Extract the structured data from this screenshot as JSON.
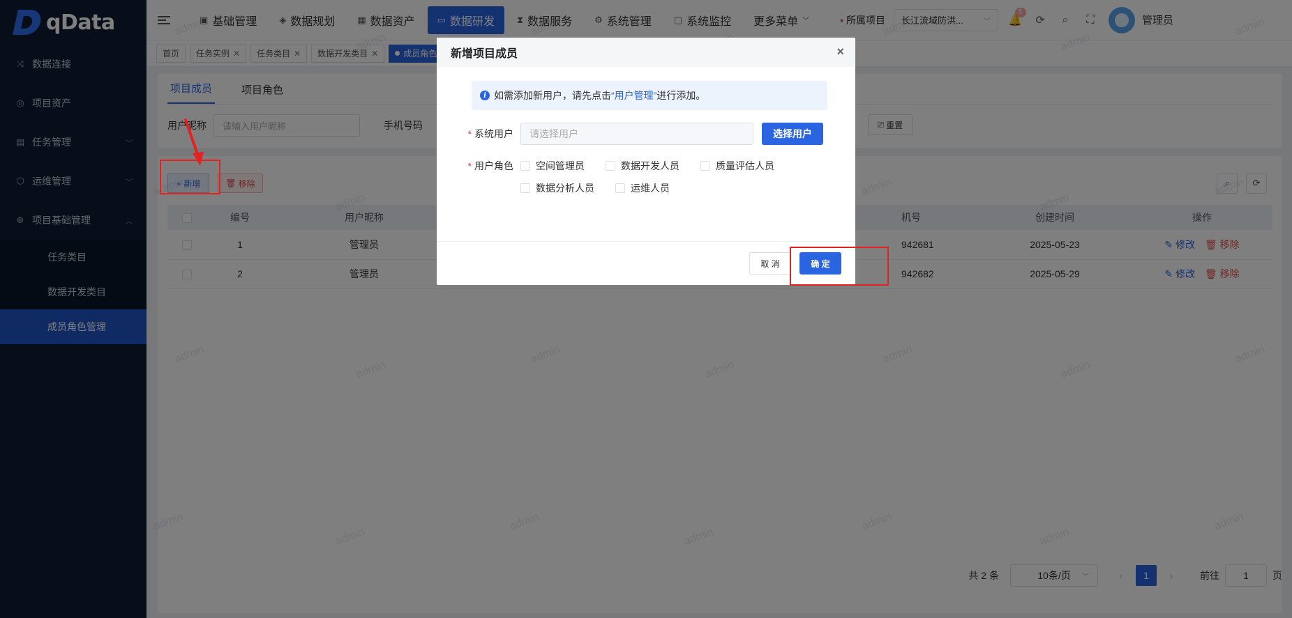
{
  "app": {
    "logo_text": "qData"
  },
  "sidebar": {
    "items": [
      {
        "label": "数据连接",
        "icon": "shuffle-icon"
      },
      {
        "label": "项目资产",
        "icon": "asset-icon"
      },
      {
        "label": "任务管理",
        "icon": "task-icon",
        "expandable": true
      },
      {
        "label": "运维管理",
        "icon": "ops-icon",
        "expandable": true
      },
      {
        "label": "项目基础管理",
        "icon": "basic-icon",
        "expanded": true
      }
    ],
    "subitems": [
      {
        "label": "任务类目"
      },
      {
        "label": "数据开发类目"
      },
      {
        "label": "成员角色管理",
        "active": true
      }
    ]
  },
  "header": {
    "nav": [
      {
        "label": "基础管理",
        "icon": "doc-icon"
      },
      {
        "label": "数据规划",
        "icon": "layers-icon"
      },
      {
        "label": "数据资产",
        "icon": "asset-icon"
      },
      {
        "label": "数据研发",
        "icon": "window-icon",
        "active": true
      },
      {
        "label": "数据服务",
        "icon": "hourglass-icon"
      },
      {
        "label": "系统管理",
        "icon": "gear-icon"
      },
      {
        "label": "系统监控",
        "icon": "monitor-icon"
      },
      {
        "label": "更多菜单"
      }
    ],
    "project_label": "所属项目",
    "project_value": "长江流域防洪...",
    "notification_badge": "5",
    "user_name": "管理员"
  },
  "tags": [
    {
      "label": "首页"
    },
    {
      "label": "任务实例",
      "closable": true
    },
    {
      "label": "任务类目",
      "closable": true
    },
    {
      "label": "数据开发类目",
      "closable": true
    },
    {
      "label": "成员角色",
      "active": true
    }
  ],
  "page": {
    "subtabs": [
      "项目成员",
      "项目角色"
    ],
    "search": {
      "nickname_label": "用户昵称",
      "nickname_placeholder": "请输入用户昵称",
      "phone_label": "手机号码",
      "reset_label": "重置"
    },
    "toolbar": {
      "add_label": "+ 新增",
      "remove_label": "移除"
    },
    "table": {
      "headers": [
        "编号",
        "用户昵称",
        "机号",
        "创建时间",
        "操作"
      ],
      "rows": [
        {
          "id": "1",
          "nickname": "管理员",
          "phone": "942681",
          "created": "2025-05-23"
        },
        {
          "id": "2",
          "nickname": "管理员",
          "phone": "942682",
          "created": "2025-05-29"
        }
      ],
      "edit_label": "修改",
      "remove_label": "移除"
    },
    "pagination": {
      "total_text": "共 2 条",
      "page_size": "10条/页",
      "current_page": "1",
      "goto_label": "前往",
      "goto_value": "1",
      "page_suffix": "页"
    }
  },
  "watermark": "admin",
  "modal": {
    "title": "新增项目成员",
    "alert_prefix": "如需添加新用户，请先点击",
    "alert_link": "“用户管理”",
    "alert_suffix": "进行添加。",
    "system_user_label": "系统用户",
    "system_user_placeholder": "请选择用户",
    "select_user_button": "选择用户",
    "role_label": "用户角色",
    "roles": [
      "空间管理员",
      "数据开发人员",
      "质量评估人员",
      "数据分析人员",
      "运维人员"
    ],
    "cancel_label": "取 消",
    "ok_label": "确 定"
  },
  "colors": {
    "primary": "#2a64e0",
    "danger": "#e04b4b",
    "sidebar_bg": "#0e1d33",
    "annotation": "#e52222"
  }
}
